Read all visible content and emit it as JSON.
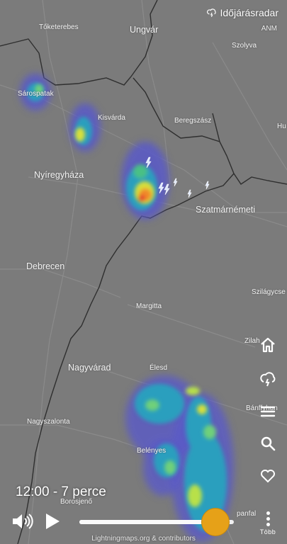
{
  "header": {
    "radar_link": "Időjárásradar",
    "provider": "ANM"
  },
  "map": {
    "places": {
      "toketerebes": "Tőketerebes",
      "ungvar": "Ungvár",
      "szolyva": "Szolyva",
      "sarospatak": "Sárospatak",
      "kisvarda": "Kisvárda",
      "beregszasz": "Beregszász",
      "hu": "Hu",
      "nyiregyhaza": "Nyíregyháza",
      "szatmarnemeti": "Szatmárnémeti",
      "debrecen": "Debrecen",
      "szilagycseh": "Szilágycse",
      "margitta": "Margitta",
      "zilah": "Zilah",
      "nagyvarad": "Nagyvárad",
      "elesd": "Élesd",
      "banffyhunyad": "Bánffyhun",
      "nagyszalonta": "Nagyszalonta",
      "belenyes": "Belényes",
      "borosjeno": "Borosjenő",
      "topanfalva": "panfal"
    }
  },
  "sidebar": {
    "buttons": [
      "home-icon",
      "storm-cloud-icon",
      "menu-icon",
      "search-icon",
      "heart-icon"
    ]
  },
  "player": {
    "time_label": "12:00 - 7 perce",
    "progress": 0.88,
    "more_label": "Több"
  },
  "footer": {
    "attribution": "Lightningmaps.org & contributors"
  },
  "colors": {
    "background": "#7b7b7b",
    "accent": "#e6a118"
  }
}
